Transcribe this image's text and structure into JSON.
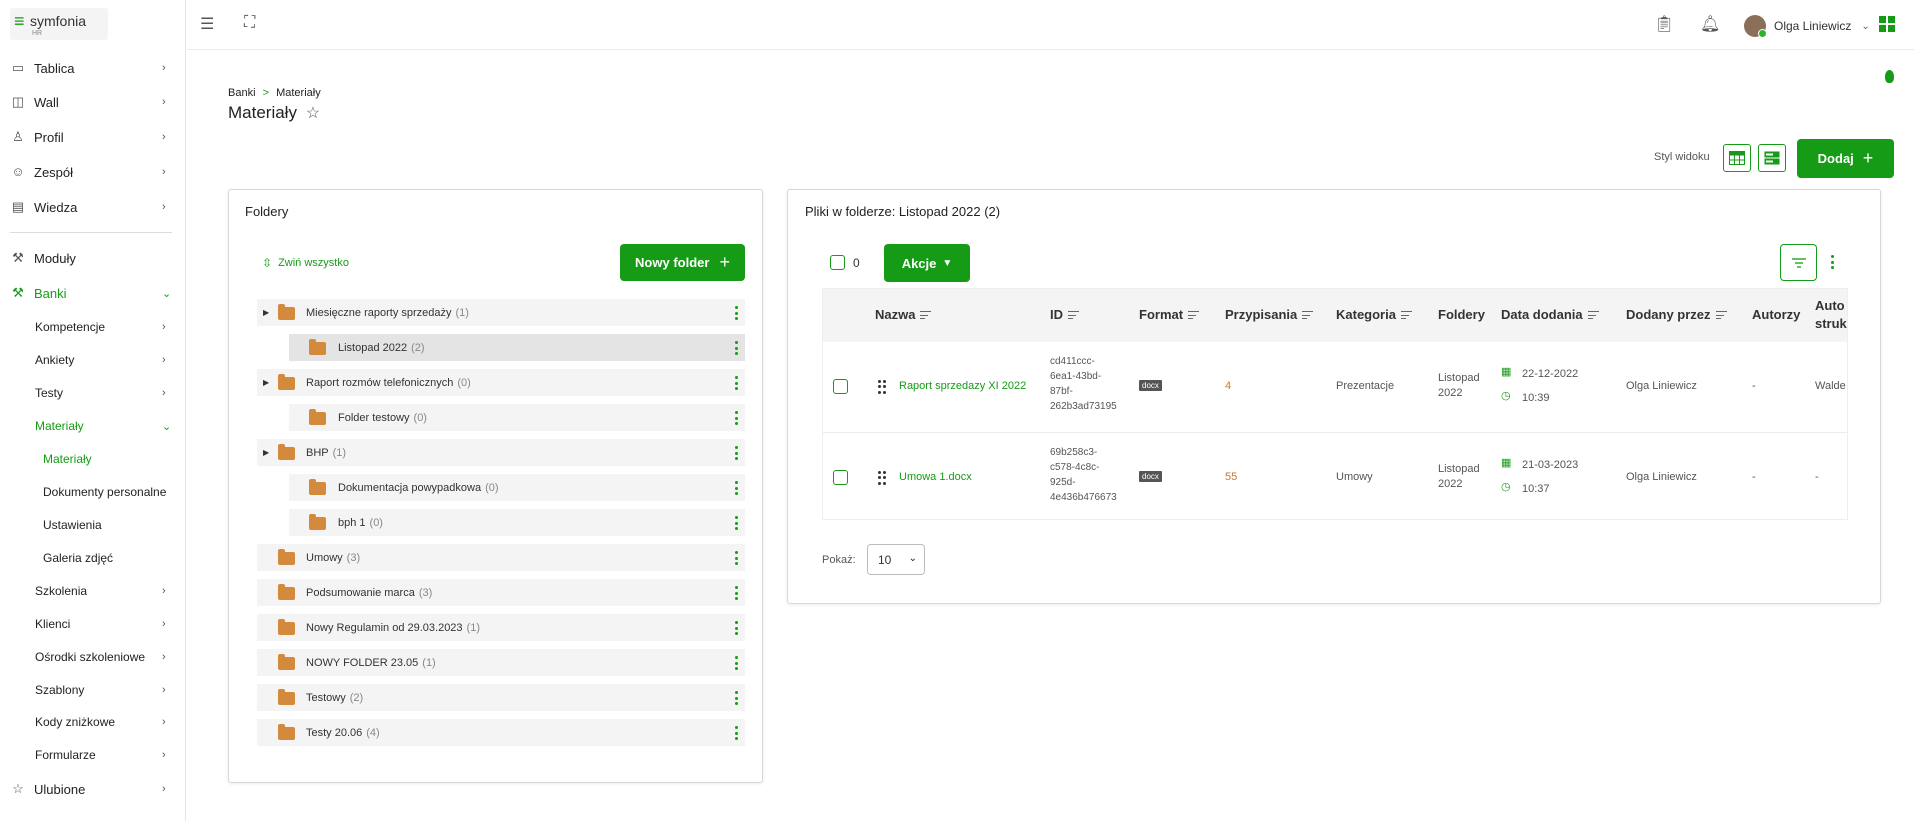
{
  "app": {
    "logo_text": "symfonia",
    "logo_sub": "HR"
  },
  "sidebar": {
    "items": [
      {
        "label": "Tablica",
        "icon": "monitor-icon"
      },
      {
        "label": "Wall",
        "icon": "chat-icon"
      },
      {
        "label": "Profil",
        "icon": "user-icon"
      },
      {
        "label": "Zespół",
        "icon": "team-icon"
      },
      {
        "label": "Wiedza",
        "icon": "book-icon"
      },
      {
        "label": "Moduły",
        "icon": "wrench-icon"
      },
      {
        "label": "Banki",
        "icon": "wrench-icon"
      }
    ],
    "banki_sub": [
      "Kompetencje",
      "Ankiety",
      "Testy",
      "Materiały"
    ],
    "materialy_sub": [
      "Materiały",
      "Dokumenty personalne",
      "Ustawienia",
      "Galeria zdjęć"
    ],
    "banki_sub2": [
      "Szkolenia",
      "Klienci",
      "Ośrodki szkoleniowe",
      "Szablony",
      "Kody zniżkowe",
      "Formularze"
    ],
    "ulubione": "Ulubione"
  },
  "topbar": {
    "user_name": "Olga Liniewicz"
  },
  "breadcrumb": {
    "root": "Banki",
    "sep": ">",
    "current": "Materiały"
  },
  "page_title": "Materiały",
  "view": {
    "label": "Styl widoku",
    "add_label": "Dodaj"
  },
  "folders_panel": {
    "title": "Foldery",
    "collapse_label": "Zwiń wszystko",
    "new_folder_label": "Nowy folder",
    "rows": [
      {
        "name": "Miesięczne raporty sprzedaży",
        "count": "(1)"
      },
      {
        "name": "Listopad 2022",
        "count": "(2)"
      },
      {
        "name": "Raport rozmów telefonicznych",
        "count": "(0)"
      },
      {
        "name": "Folder testowy",
        "count": "(0)"
      },
      {
        "name": "BHP",
        "count": "(1)"
      },
      {
        "name": "Dokumentacja powypadkowa",
        "count": "(0)"
      },
      {
        "name": "bph 1",
        "count": "(0)"
      },
      {
        "name": "Umowy",
        "count": "(3)"
      },
      {
        "name": "Podsumowanie marca",
        "count": "(3)"
      },
      {
        "name": "Nowy Regulamin od 29.03.2023",
        "count": "(1)"
      },
      {
        "name": "NOWY FOLDER 23.05",
        "count": "(1)"
      },
      {
        "name": "Testowy",
        "count": "(2)"
      },
      {
        "name": "Testy 20.06",
        "count": "(4)"
      }
    ]
  },
  "files_panel": {
    "title": "Pliki w folderze: Listopad 2022 (2)",
    "selected_count": "0",
    "actions_label": "Akcje",
    "headers": [
      "Nazwa",
      "ID",
      "Format",
      "Przypisania",
      "Kategoria",
      "Foldery",
      "Data dodania",
      "Dodany przez",
      "Autorzy",
      "Auto struk"
    ],
    "rows": [
      {
        "name": "Raport sprzedazy XI 2022",
        "id": [
          "cd411ccc-",
          "6ea1-43bd-",
          "87bf-",
          "262b3ad73195"
        ],
        "format": "docx",
        "assign": "4",
        "category": "Prezentacje",
        "folder": [
          "Listopad",
          "2022"
        ],
        "date": "22-12-2022",
        "time": "10:39",
        "by": "Olga Liniewicz",
        "authors": "-",
        "auto": "Walde"
      },
      {
        "name": "Umowa 1.docx",
        "id": [
          "69b258c3-",
          "c578-4c8c-",
          "925d-",
          "4e436b476673"
        ],
        "format": "docx",
        "assign": "55",
        "category": "Umowy",
        "folder": [
          "Listopad",
          "2022"
        ],
        "date": "21-03-2023",
        "time": "10:37",
        "by": "Olga Liniewicz",
        "authors": "-",
        "auto": "-"
      }
    ],
    "show_label": "Pokaż:",
    "page_size": "10"
  },
  "colors": {
    "accent": "#169b16",
    "folder": "#d48a3c",
    "assign": "#c9762a"
  }
}
